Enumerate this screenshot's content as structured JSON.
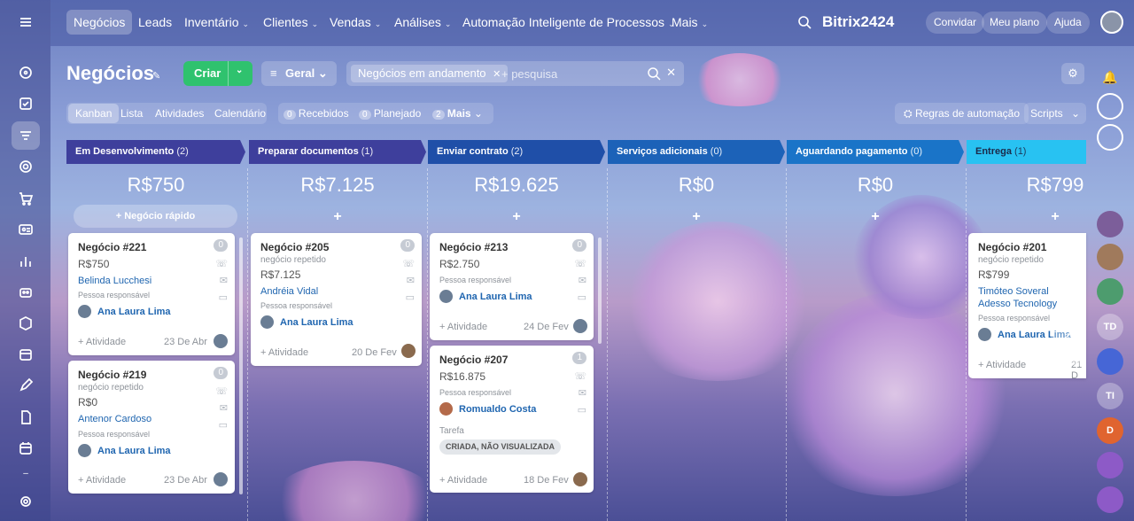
{
  "topnav": {
    "items": [
      "Negócios",
      "Leads",
      "Inventário",
      "Clientes",
      "Vendas",
      "Análises",
      "Automação Inteligente de Processos",
      "Mais"
    ],
    "brand": "Bitrix24",
    "brand_num": "24",
    "invite": "Convidar",
    "plan": "Meu plano",
    "help": "Ajuda"
  },
  "page": {
    "title": "Negócios",
    "create": "Criar",
    "general": "Geral",
    "filter_chip": "Negócios em andamento",
    "search_placeholder": "+ pesquisa"
  },
  "tabs": [
    "Kanban",
    "Lista",
    "Atividades",
    "Calendário"
  ],
  "counters": [
    {
      "n": "0",
      "label": "Recebidos"
    },
    {
      "n": "0",
      "label": "Planejado"
    },
    {
      "n": "2",
      "label": "Mais"
    }
  ],
  "tools": {
    "automation": "Regras de automação",
    "scripts": "Scripts"
  },
  "quick_deal": "+ Negócio rápido",
  "columns": [
    {
      "name": "Em Desenvolvimento",
      "count": "(2)",
      "amount": "R$750",
      "color": "#3e3f9c"
    },
    {
      "name": "Preparar documentos",
      "count": "(1)",
      "amount": "R$7.125",
      "color": "#3e3f9c"
    },
    {
      "name": "Enviar contrato",
      "count": "(2)",
      "amount": "R$19.625",
      "color": "#1f4fa8"
    },
    {
      "name": "Serviços adicionais",
      "count": "(0)",
      "amount": "R$0",
      "color": "#1c62b8"
    },
    {
      "name": "Aguardando pagamento",
      "count": "(0)",
      "amount": "R$0",
      "color": "#1a74c8"
    },
    {
      "name": "Entrega",
      "count": "(1)",
      "amount": "R$799",
      "color": "#28c2f2"
    }
  ],
  "cards": {
    "c221": {
      "title": "Negócio #221",
      "badge": "0",
      "money": "R$750",
      "contact": "Belinda Lucchesi",
      "resp_label": "Pessoa responsável",
      "person": "Ana Laura Lima",
      "activity": "+ Atividade",
      "date": "23 De Abr"
    },
    "c219": {
      "title": "Negócio #219",
      "badge": "0",
      "sub": "negócio repetido",
      "money": "R$0",
      "contact": "Antenor Cardoso",
      "resp_label": "Pessoa responsável",
      "person": "Ana Laura Lima",
      "activity": "+ Atividade",
      "date": "23 De Abr"
    },
    "c205": {
      "title": "Negócio #205",
      "badge": "0",
      "sub": "negócio repetido",
      "money": "R$7.125",
      "contact": "Andréia Vidal",
      "resp_label": "Pessoa responsável",
      "person": "Ana Laura Lima",
      "activity": "+ Atividade",
      "date": "20 De Fev"
    },
    "c213": {
      "title": "Negócio #213",
      "badge": "0",
      "money": "R$2.750",
      "resp_label": "Pessoa responsável",
      "person": "Ana Laura Lima",
      "activity": "+ Atividade",
      "date": "24 De Fev"
    },
    "c207": {
      "title": "Negócio #207",
      "badge": "1",
      "money": "R$16.875",
      "resp_label": "Pessoa responsável",
      "person": "Romualdo Costa",
      "task_label": "Tarefa",
      "task_status": "CRIADA, NÃO VISUALIZADA",
      "activity": "+ Atividade",
      "date": "18 De Fev"
    },
    "c201": {
      "title": "Negócio #201",
      "sub": "negócio repetido",
      "money": "R$799",
      "contact": "Timóteo Soveral",
      "company": "Adesso Tecnology",
      "resp_label": "Pessoa responsável",
      "person": "Ana Laura Lima",
      "activity": "+ Atividade",
      "date": "21 D"
    }
  },
  "rightbar": {
    "td": "TD",
    "ti": "TI",
    "d": "D"
  }
}
